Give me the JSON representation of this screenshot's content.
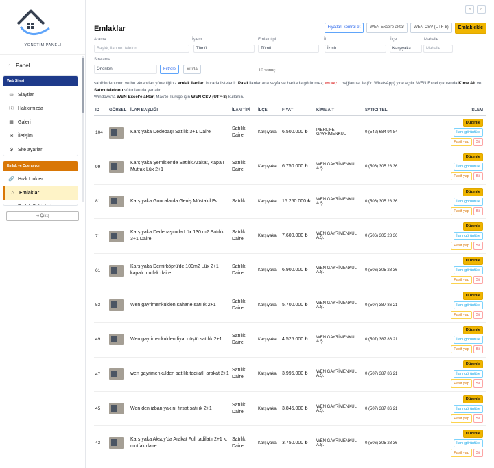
{
  "sidebar": {
    "logo_text": "YÖNETİM PANELİ",
    "panel_label": "Panel",
    "web_section": {
      "title": "Web Sitesi",
      "color": "#1e3a8a",
      "items": [
        {
          "label": "Slaytlar",
          "icon": "slides-icon",
          "glyph": "▭"
        },
        {
          "label": "Hakkımızda",
          "icon": "info-icon",
          "glyph": "ⓘ"
        },
        {
          "label": "Galeri",
          "icon": "gallery-icon",
          "glyph": "▦"
        },
        {
          "label": "İletişim",
          "icon": "message-icon",
          "glyph": "✉"
        },
        {
          "label": "Site ayarları",
          "icon": "gear-icon",
          "glyph": "⚙"
        }
      ]
    },
    "emlak_section": {
      "title": "Emlak ve Operasyon",
      "color": "#d97706",
      "items": [
        {
          "label": "Hızlı Linkler",
          "icon": "link-icon",
          "glyph": "🔗",
          "active": false
        },
        {
          "label": "Emlaklar",
          "icon": "home-icon",
          "glyph": "⌂",
          "active": true
        },
        {
          "label": "Emlak Sahipleri",
          "icon": "users-icon",
          "glyph": "☺",
          "active": false
        }
      ]
    },
    "logout_label": "Çıkış"
  },
  "page": {
    "title": "Emlaklar",
    "buttons": {
      "check_prices": "Fiyatları kontrol et",
      "excel_export": "WEN Excel'e aktar",
      "csv_export": "WEN CSV (UTF-8)",
      "add": "Emlak ekle"
    }
  },
  "filters": {
    "search": {
      "label": "Arama",
      "placeholder": "Başlık, ilan no, telefon..."
    },
    "listing_type": {
      "label": "İşlem",
      "value": "Tümü"
    },
    "property_type": {
      "label": "Emlak tipi",
      "value": "Tümü"
    },
    "city": {
      "label": "İl",
      "value": "İzmir"
    },
    "district": {
      "label": "İlçe",
      "value": "Karşıyaka"
    },
    "neighborhood": {
      "label": "Mahalle",
      "placeholder": "Mahalle"
    },
    "sort": {
      "label": "Sıralama",
      "value": "Önerilen"
    },
    "filter_btn": "Filtrele",
    "reset_btn": "Sıfırla",
    "result_count": "10 sonuç"
  },
  "info": {
    "p1": "sahibinden.com ve bu ekrandan yönettiğiniz",
    "p1b": "emlak ilanları",
    "p1c": "burada listelenir.",
    "p1d": "Pasif",
    "p1e": "ilanlar ana sayfa ve haritada görünmez;",
    "p1code": "emlak/…",
    "p1f": "bağlantısı ile (ör. WhatsApp) yine açılır. WEN Excel çıktısında",
    "p1g": "Kime Ait",
    "p1h": "ve",
    "p1i": "Satıcı telefonu",
    "p1j": "sütunları da yer alır.",
    "p2": "Windows'ta",
    "p2b": "WEN Excel'e aktar",
    "p2c": "; Mac'te Türkçe için",
    "p2d": "WEN CSV (UTF-8)",
    "p2e": "kullanın."
  },
  "table": {
    "headers": [
      "ID",
      "GÖRSEL",
      "İLAN BAŞLIĞI",
      "İLAN TİPİ",
      "İLÇE",
      "FİYAT",
      "KİME AİT",
      "SATICI TEL.",
      "İŞLEM"
    ],
    "actions": {
      "edit": "Düzenle",
      "view": "İlanı görüntüle",
      "deactivate": "Pasif yap",
      "delete": "Sil"
    },
    "rows": [
      {
        "id": "104",
        "title": "Karşıyaka Dedebaşı Satılık 3+1 Daire",
        "type": "Satılık Daire",
        "district": "Karşıyaka",
        "price": "6.500.000 ₺",
        "owner": "PIERLIFE GAYRİMENKUL",
        "phone": "0 (542) 684 94 84"
      },
      {
        "id": "99",
        "title": "Karşıyaka Şemikler'de Satılık Arakat, Kapalı Mutfak Lüx 2+1",
        "type": "Satılık Daire",
        "district": "Karşıyaka",
        "price": "6.750.000 ₺",
        "owner": "WEN GAYRİMENKUL A.Ş.",
        "phone": "0 (506) 305 28 36"
      },
      {
        "id": "81",
        "title": "Karşıyaka Goncalarda Geniş Müstakil Ev",
        "type": "Satılık",
        "district": "Karşıyaka",
        "price": "15.250.000 ₺",
        "owner": "WEN GAYRİMENKUL A.Ş.",
        "phone": "0 (506) 305 28 36"
      },
      {
        "id": "71",
        "title": "Karşıyaka Dedebaşı'nda Lüx 130 m2 Satılık 3+1 Daire",
        "type": "Satılık Daire",
        "district": "Karşıyaka",
        "price": "7.600.000 ₺",
        "owner": "WEN GAYRİMENKUL A.Ş.",
        "phone": "0 (506) 305 28 36"
      },
      {
        "id": "61",
        "title": "Karşıyaka Demirköprü'de 100m2 Lüx 2+1 kapalı mutfak daire",
        "type": "Satılık Daire",
        "district": "Karşıyaka",
        "price": "6.900.000 ₺",
        "owner": "WEN GAYRİMENKUL A.Ş.",
        "phone": "0 (506) 305 28 36"
      },
      {
        "id": "53",
        "title": "Wen gayrimenkulden şahane satılık 2+1",
        "type": "Satılık Daire",
        "district": "Karşıyaka",
        "price": "5.700.000 ₺",
        "owner": "WEN GAYRİMENKUL A.Ş.",
        "phone": "0 (507) 387 86 21"
      },
      {
        "id": "49",
        "title": "Wen gayrimenkulden fiyat düştü satılık 2+1",
        "type": "Satılık Daire",
        "district": "Karşıyaka",
        "price": "4.525.000 ₺",
        "owner": "WEN GAYRİMENKUL A.Ş.",
        "phone": "0 (507) 387 86 21"
      },
      {
        "id": "47",
        "title": "wen gayrimenkulden satılık tadilatlı arakat 2+1",
        "type": "Satılık Daire",
        "district": "Karşıyaka",
        "price": "3.995.000 ₺",
        "owner": "WEN GAYRİMENKUL A.Ş.",
        "phone": "0 (507) 387 86 21"
      },
      {
        "id": "45",
        "title": "Wen den izban yakını fırsat satılık 2+1",
        "type": "Satılık Daire",
        "district": "Karşıyaka",
        "price": "3.845.000 ₺",
        "owner": "WEN GAYRİMENKUL A.Ş.",
        "phone": "0 (507) 387 86 21"
      },
      {
        "id": "43",
        "title": "Karşıyaka Aksoy'da Arakat Full tadilatlı 2+1 k. mutfak daire",
        "type": "Satılık Daire",
        "district": "Karşıyaka",
        "price": "3.750.000 ₺",
        "owner": "WEN GAYRİMENKUL A.Ş.",
        "phone": "0 (506) 305 28 36"
      }
    ]
  }
}
